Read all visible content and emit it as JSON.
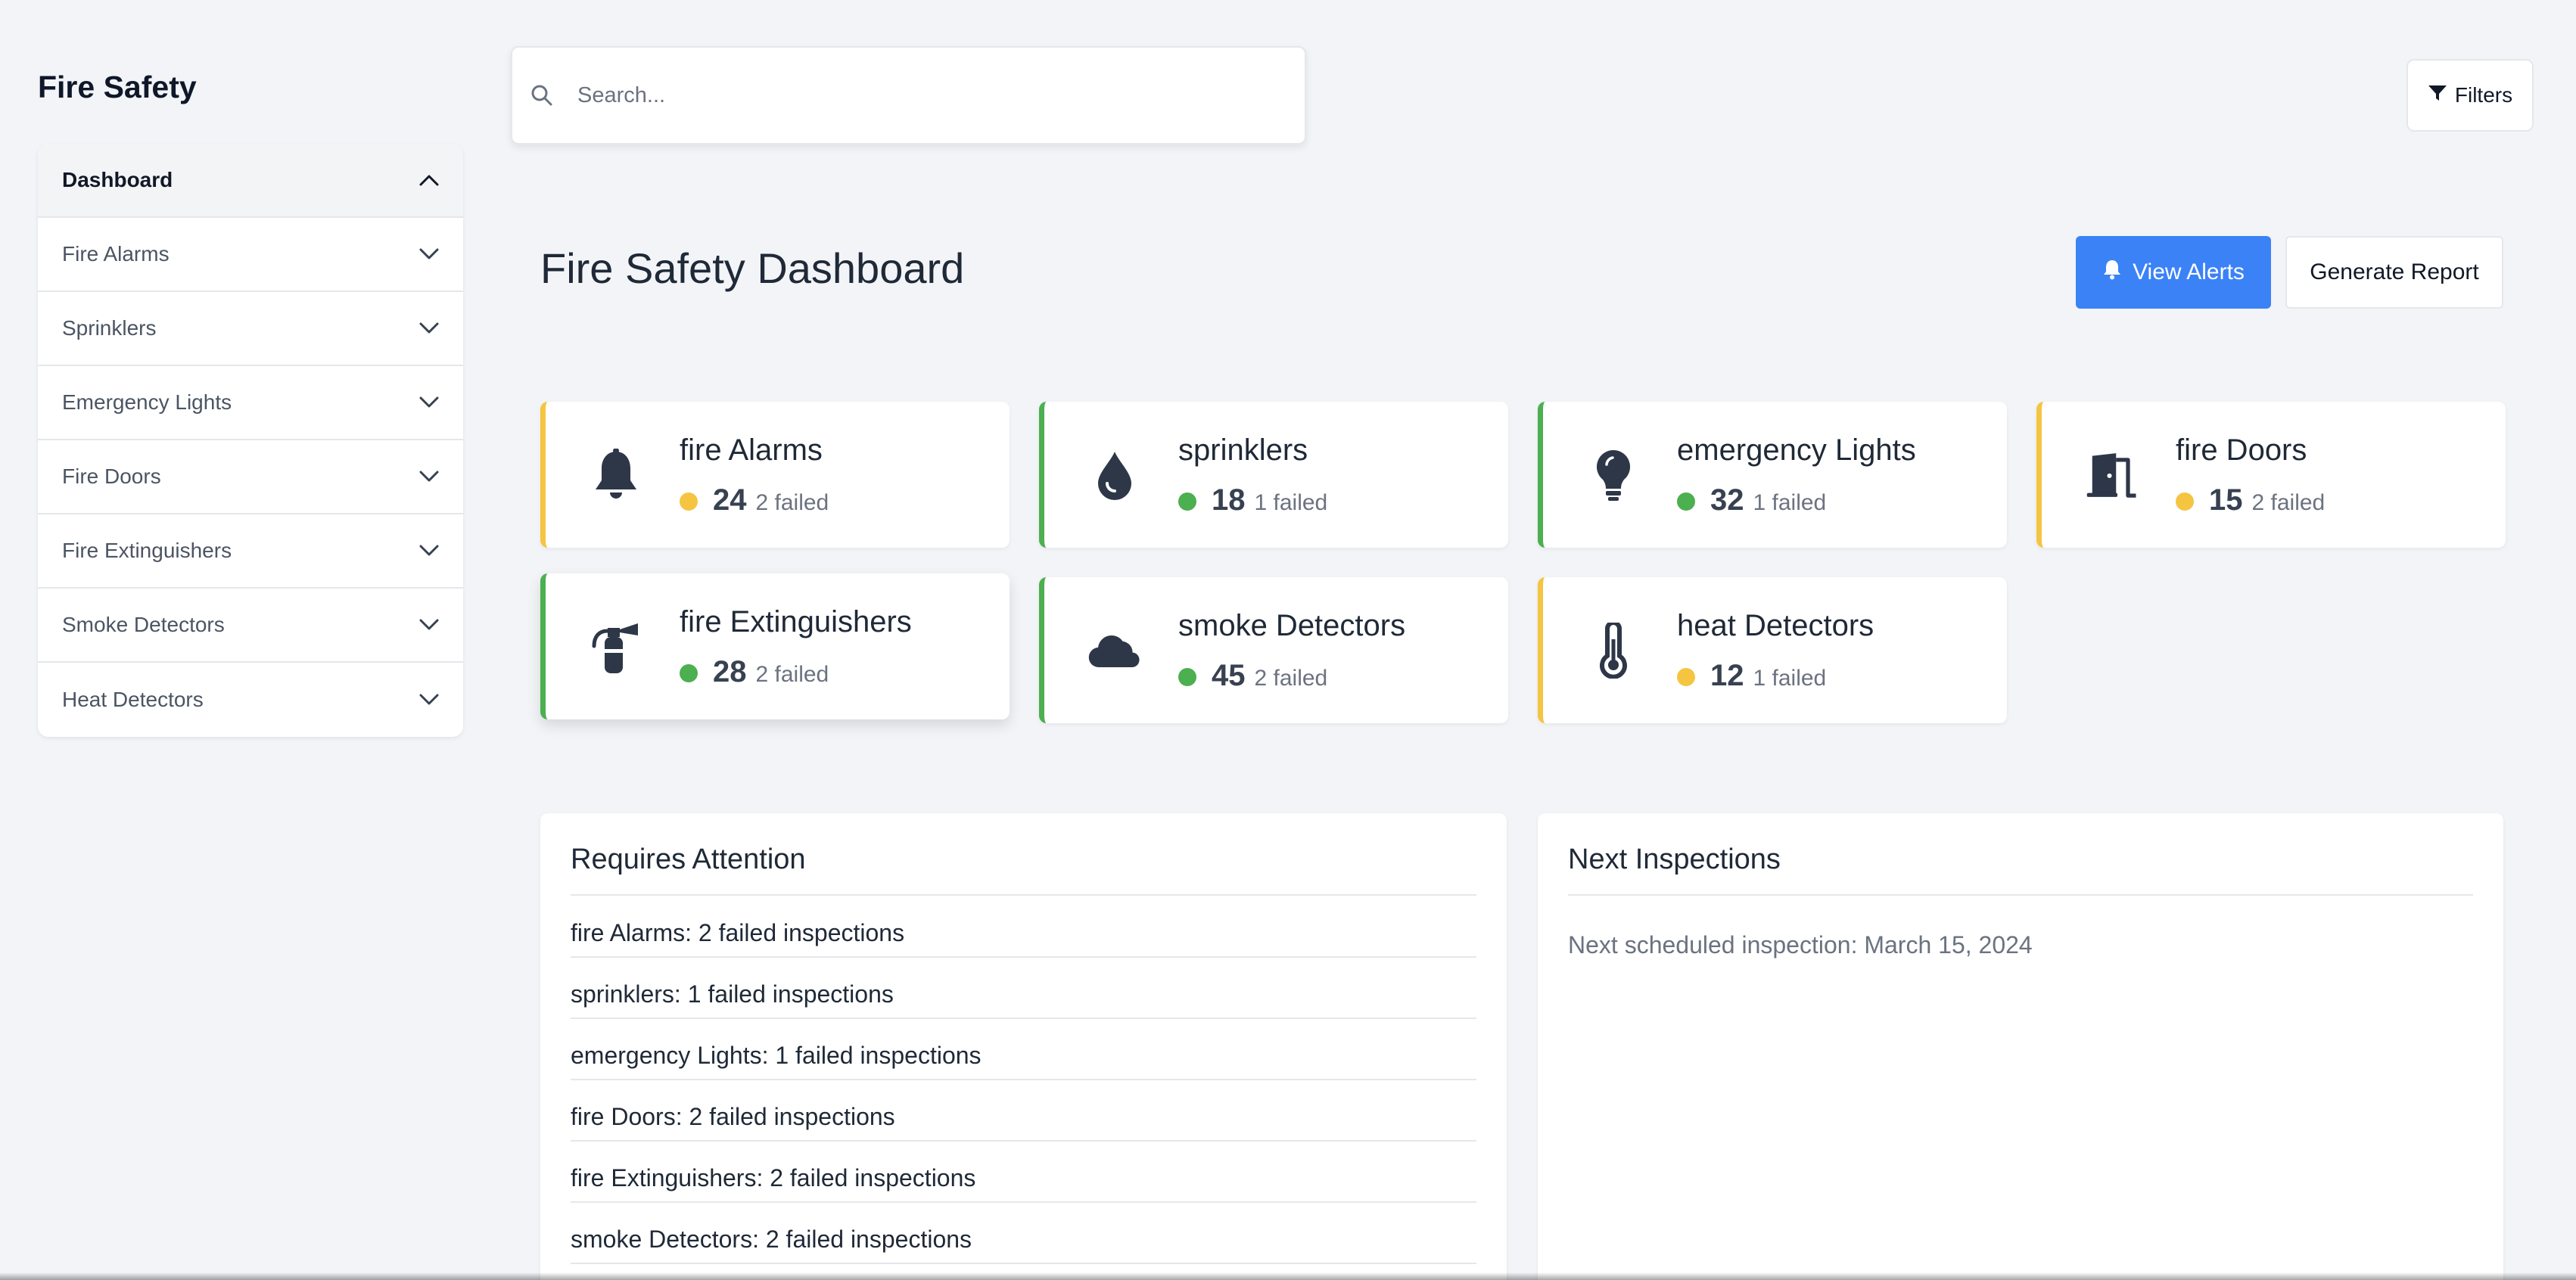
{
  "app": {
    "title": "Fire Safety"
  },
  "search": {
    "placeholder": "Search..."
  },
  "filters": {
    "label": "Filters"
  },
  "page": {
    "title": "Fire Safety Dashboard"
  },
  "actions": {
    "view_alerts": "View Alerts",
    "generate_report": "Generate Report"
  },
  "sidebar": {
    "items": [
      {
        "label": "Dashboard",
        "expanded": true
      },
      {
        "label": "Fire Alarms",
        "expanded": false
      },
      {
        "label": "Sprinklers",
        "expanded": false
      },
      {
        "label": "Emergency Lights",
        "expanded": false
      },
      {
        "label": "Fire Doors",
        "expanded": false
      },
      {
        "label": "Fire Extinguishers",
        "expanded": false
      },
      {
        "label": "Smoke Detectors",
        "expanded": false
      },
      {
        "label": "Heat Detectors",
        "expanded": false
      }
    ]
  },
  "stats": [
    {
      "title": "fire Alarms",
      "count": "24",
      "failed": "2 failed",
      "status": "warning",
      "icon": "bell-icon"
    },
    {
      "title": "sprinklers",
      "count": "18",
      "failed": "1 failed",
      "status": "ok",
      "icon": "droplet-icon"
    },
    {
      "title": "emergency Lights",
      "count": "32",
      "failed": "1 failed",
      "status": "ok",
      "icon": "lightbulb-icon"
    },
    {
      "title": "fire Doors",
      "count": "15",
      "failed": "2 failed",
      "status": "warning",
      "icon": "door-icon"
    },
    {
      "title": "fire Extinguishers",
      "count": "28",
      "failed": "2 failed",
      "status": "ok",
      "icon": "fire-extinguisher-icon"
    },
    {
      "title": "smoke Detectors",
      "count": "45",
      "failed": "2 failed",
      "status": "ok",
      "icon": "cloud-icon"
    },
    {
      "title": "heat Detectors",
      "count": "12",
      "failed": "1 failed",
      "status": "warning",
      "icon": "thermometer-icon"
    }
  ],
  "attention": {
    "title": "Requires Attention",
    "items": [
      "fire Alarms: 2 failed inspections",
      "sprinklers: 1 failed inspections",
      "emergency Lights: 1 failed inspections",
      "fire Doors: 2 failed inspections",
      "fire Extinguishers: 2 failed inspections",
      "smoke Detectors: 2 failed inspections"
    ]
  },
  "inspections": {
    "title": "Next Inspections",
    "text": "Next scheduled inspection: March 15, 2024"
  },
  "colors": {
    "accent": "#3b82f6",
    "ok": "#4caf50",
    "warning": "#f5c542",
    "icon": "#2d3748"
  }
}
